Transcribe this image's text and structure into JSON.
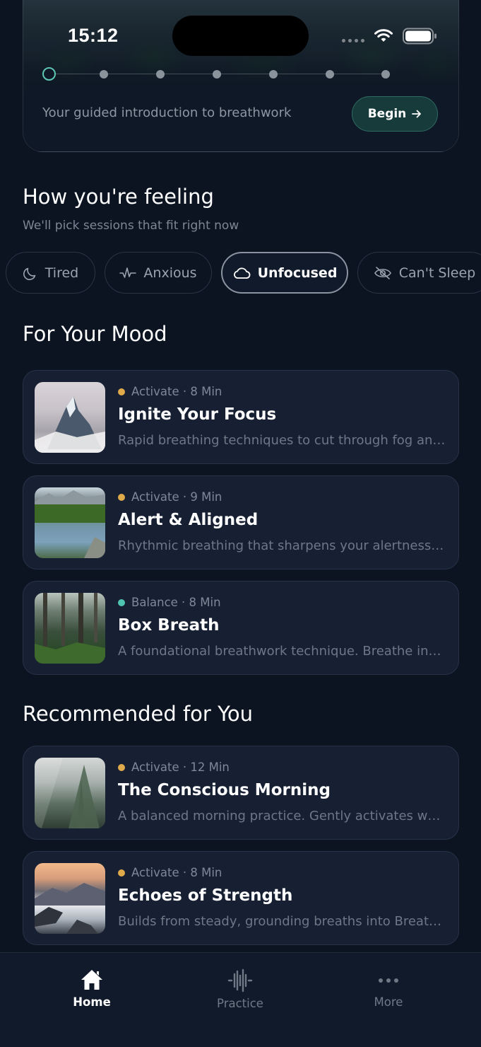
{
  "status_bar": {
    "time": "15:12"
  },
  "hero": {
    "subtitle": "Your guided introduction to breathwork",
    "begin_label": "Begin",
    "steps_total": 7,
    "current_step": 1
  },
  "feeling": {
    "title": "How you're feeling",
    "subtitle": "We'll pick sessions that fit right now",
    "chips": [
      {
        "label": "Tired",
        "icon": "moon-icon",
        "selected": false
      },
      {
        "label": "Anxious",
        "icon": "pulse-icon",
        "selected": false
      },
      {
        "label": "Unfocused",
        "icon": "cloud-icon",
        "selected": true
      },
      {
        "label": "Can't Sleep",
        "icon": "eye-off-icon",
        "selected": false
      }
    ]
  },
  "mood": {
    "title": "For Your Mood",
    "sessions": [
      {
        "category": "Activate",
        "duration": "8 Min",
        "meta": "Activate · 8 Min",
        "title": "Ignite Your Focus",
        "description": "Rapid breathing techniques to cut through fog an…",
        "dot_color": "#e0a94a"
      },
      {
        "category": "Activate",
        "duration": "9 Min",
        "meta": "Activate · 9 Min",
        "title": "Alert & Aligned",
        "description": "Rhythmic breathing that sharpens your alertness…",
        "dot_color": "#e0a94a"
      },
      {
        "category": "Balance",
        "duration": "8 Min",
        "meta": "Balance · 8 Min",
        "title": "Box Breath",
        "description": "A foundational breathwork technique. Breathe in…",
        "dot_color": "#4fc4b0"
      }
    ]
  },
  "recommended": {
    "title": "Recommended for You",
    "sessions": [
      {
        "category": "Activate",
        "duration": "12 Min",
        "meta": "Activate · 12 Min",
        "title": "The Conscious Morning",
        "description": "A balanced morning practice. Gently activates wh…",
        "dot_color": "#e0a94a"
      },
      {
        "category": "Activate",
        "duration": "8 Min",
        "meta": "Activate · 8 Min",
        "title": "Echoes of Strength",
        "description": "Builds from steady, grounding breaths into Breath…",
        "dot_color": "#e0a94a"
      }
    ]
  },
  "nav": {
    "items": [
      {
        "label": "Home",
        "icon": "home-icon",
        "active": true
      },
      {
        "label": "Practice",
        "icon": "waveform-icon",
        "active": false
      },
      {
        "label": "More",
        "icon": "more-dots-icon",
        "active": false
      }
    ]
  }
}
